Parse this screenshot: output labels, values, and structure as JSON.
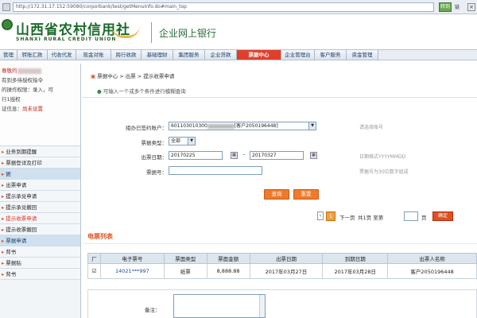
{
  "browser": {
    "url": "http://172.31.17.152:59080/corporbank/test/getMenuInfo.do#main_top",
    "go_label": "转到",
    "links_label": "链"
  },
  "header": {
    "brand_cn": "山西省农村信用社",
    "brand_en": "SHANXI RURAL CREDIT UNION",
    "subtitle": "企业网上银行"
  },
  "nav": {
    "tabs": [
      "管理",
      "转账汇款",
      "代收代发",
      "现金对账",
      "跨行收款",
      "基础理财",
      "集团服务",
      "企业贷款",
      "票据中心",
      "企业管理台",
      "客户服务",
      "资金管理"
    ],
    "active_index": 8
  },
  "sidebar": {
    "user_lines": [
      {
        "text": "尊敬的",
        "red": true
      },
      {
        "text": "有到多待授权指令",
        "red": false
      },
      {
        "text": "的操作权限：录入，可",
        "red": false
      },
      {
        "text": "行1授权",
        "red": false
      },
      {
        "text": "证信息：",
        "red": false,
        "suffix": "尚未设置"
      }
    ],
    "menu": [
      {
        "label": "业务到期提醒",
        "style": "plain"
      },
      {
        "label": "票据登详及打印",
        "style": "plain"
      },
      {
        "label": "据",
        "style": "blue"
      },
      {
        "label": "出票申请",
        "style": "plain"
      },
      {
        "label": "提示承兑申请",
        "style": "plain"
      },
      {
        "label": "提示承兑撤回",
        "style": "plain"
      },
      {
        "label": "提示收票申请",
        "style": "red"
      },
      {
        "label": "提示收票撤回",
        "style": "plain"
      },
      {
        "label": "票据申请",
        "style": "blue"
      },
      {
        "label": "背书",
        "style": "plain"
      },
      {
        "label": "票据贴",
        "style": "plain"
      },
      {
        "label": "背书",
        "style": "plain"
      }
    ]
  },
  "main": {
    "breadcrumb": "票据中心 > 出票 > 提示收票申请",
    "tip": "可输入一个或多个条件进行模糊查询",
    "form": {
      "account_label": "组办已签约账户：",
      "account_value": "601103010300",
      "account_suffix": "[客户2050196448]",
      "type_label": "票据类型：",
      "type_value": "全部",
      "date_label": "出票日期：",
      "date_from": "20170225",
      "date_to": "20170327",
      "billno_label": "票据号：",
      "billno_value": "",
      "hint_account": "请选择账号",
      "hint_date": "日期格式YYYYMMDD",
      "hint_billno": "票据号为30位数字组成"
    },
    "query_label": "查询",
    "reset_label": "重置",
    "pager": {
      "current_page": "1",
      "next_label": "下一页",
      "total_label": "共1页 至第",
      "page_unit": "页",
      "goto_label": "确定"
    },
    "list_title": "电票列表",
    "table": {
      "headers": [
        "",
        "电子票号",
        "票面类型",
        "票面金额",
        "出票日期",
        "到期日期",
        "出票人名称"
      ],
      "rows": [
        {
          "checked": "☑",
          "bill_no": "14021***997",
          "type": "纸票",
          "amount": "8,888.88",
          "issue_date": "2017年03月27日",
          "due_date": "2017年03月28日",
          "drawer": "客户2050196448"
        }
      ]
    },
    "remark_label": "备注："
  }
}
